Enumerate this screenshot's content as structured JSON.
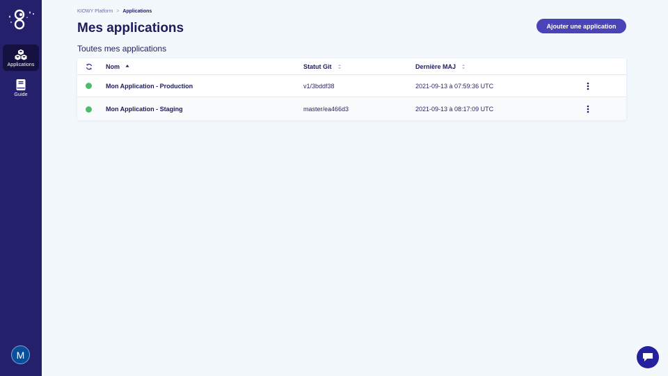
{
  "sidebar": {
    "items": [
      {
        "label": "Applications",
        "icon": "cubes-icon",
        "active": true
      },
      {
        "label": "Guide",
        "icon": "book-icon",
        "active": false
      }
    ],
    "avatar_initial": "M"
  },
  "breadcrumb": {
    "root": "KIOWY Platform",
    "separator": ">",
    "current": "Applications"
  },
  "page": {
    "title": "Mes applications",
    "add_button": "Ajouter une application",
    "section_title": "Toutes mes applications"
  },
  "table": {
    "headers": {
      "name": "Nom",
      "git": "Statut Git",
      "date": "Dernière MAJ"
    },
    "rows": [
      {
        "name": "Mon Application - Production",
        "git": "v1/3bddf38",
        "date": "2021-09-13 à 07:59:36 UTC",
        "status": "online"
      },
      {
        "name": "Mon Application - Staging",
        "git": "master/ea466d3",
        "date": "2021-09-13 à 08:17:09 UTC",
        "status": "online"
      }
    ]
  },
  "colors": {
    "sidebar": "#25206b",
    "accent": "#4a44b8",
    "status_online": "#4cbb6c",
    "background": "#f3f8fd"
  }
}
